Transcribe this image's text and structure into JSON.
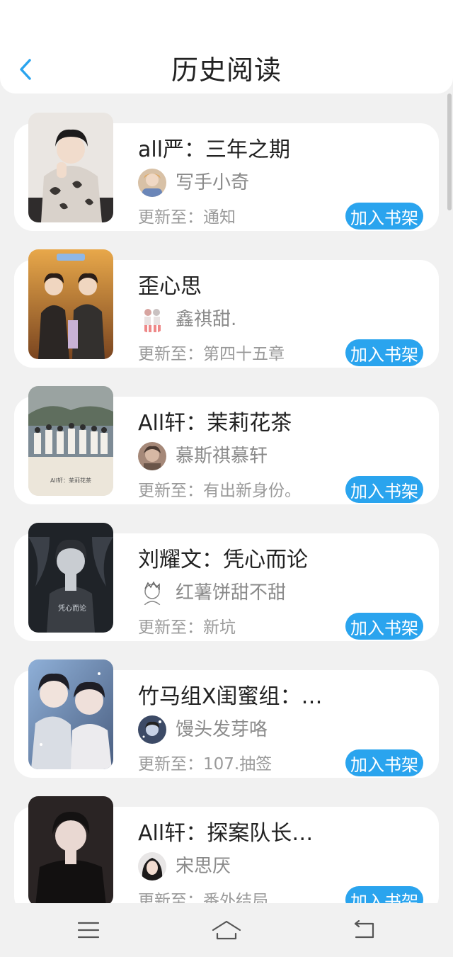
{
  "header": {
    "title": "历史阅读"
  },
  "colors": {
    "accent": "#2aa4ee",
    "background": "#f1f1f1"
  },
  "books": [
    {
      "title": "all严：三年之期",
      "author": "写手小奇",
      "update_label": "更新至：",
      "update": "通知",
      "add_label": "加入书架"
    },
    {
      "title": "歪心思",
      "author": "鑫祺甜.",
      "update_label": "更新至：",
      "update": "第四十五章",
      "add_label": "加入书架"
    },
    {
      "title": "All轩：茉莉花茶",
      "author": "慕斯祺慕轩",
      "update_label": "更新至：",
      "update": "有出新身份。",
      "add_label": "加入书架"
    },
    {
      "title": "刘耀文：凭心而论",
      "author": "红薯饼甜不甜",
      "update_label": "更新至：",
      "update": "新坑",
      "add_label": "加入书架"
    },
    {
      "title": "竹马组X闺蜜组：…",
      "author": "馒头发芽咯",
      "update_label": "更新至：",
      "update": "107.抽签",
      "add_label": "加入书架"
    },
    {
      "title": "All轩：探案队长…",
      "author": "宋思厌",
      "update_label": "更新至：",
      "update": "番外结局",
      "add_label": "加入书架"
    }
  ],
  "cover_texts": {
    "book3": "All轩：茉莉花茶",
    "book4": "凭心而论"
  },
  "navbar": {
    "icons": [
      "menu-icon",
      "home-icon",
      "back-icon"
    ]
  }
}
